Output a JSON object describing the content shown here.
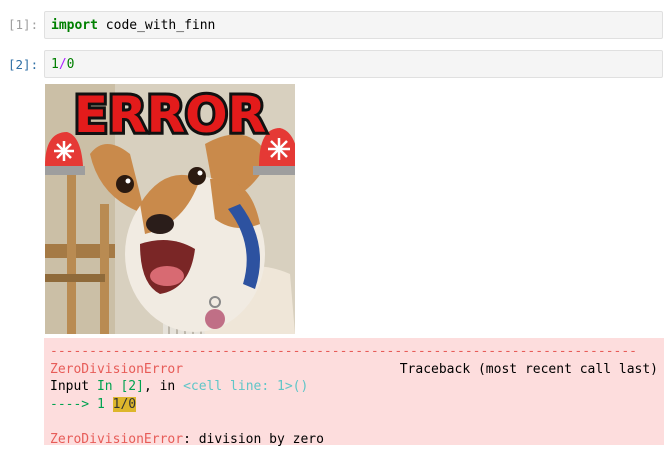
{
  "cells": [
    {
      "prompt": "[1]:",
      "code": {
        "keyword": "import",
        "module": "code_with_finn"
      }
    },
    {
      "prompt": "[2]:",
      "code": {
        "num1": "1",
        "op": "/",
        "num2": "0"
      }
    }
  ],
  "output_image": {
    "banner_text": "ERROR",
    "subject": "dog with blue collar, siren emojis"
  },
  "traceback": {
    "separator": "---------------------------------------------------------------------------",
    "error_name": "ZeroDivisionError",
    "traceback_header": "Traceback (most recent call last)",
    "input_label": "Input",
    "input_ref": "In [2]",
    "input_in": ", in ",
    "cell_line": "<cell line: 1>()",
    "arrow": "---->",
    "line_no": "1",
    "line_code": "1/0",
    "final_error_name": "ZeroDivisionError",
    "final_message": ": division by zero"
  },
  "colors": {
    "traceback_bg": "#fddddd",
    "error_red": "#e75c58",
    "arrow_green": "#00a250",
    "highlight": "#ddb62b",
    "prompt_blue": "#2f6fa5",
    "prompt_gray": "#9e9e9e"
  }
}
